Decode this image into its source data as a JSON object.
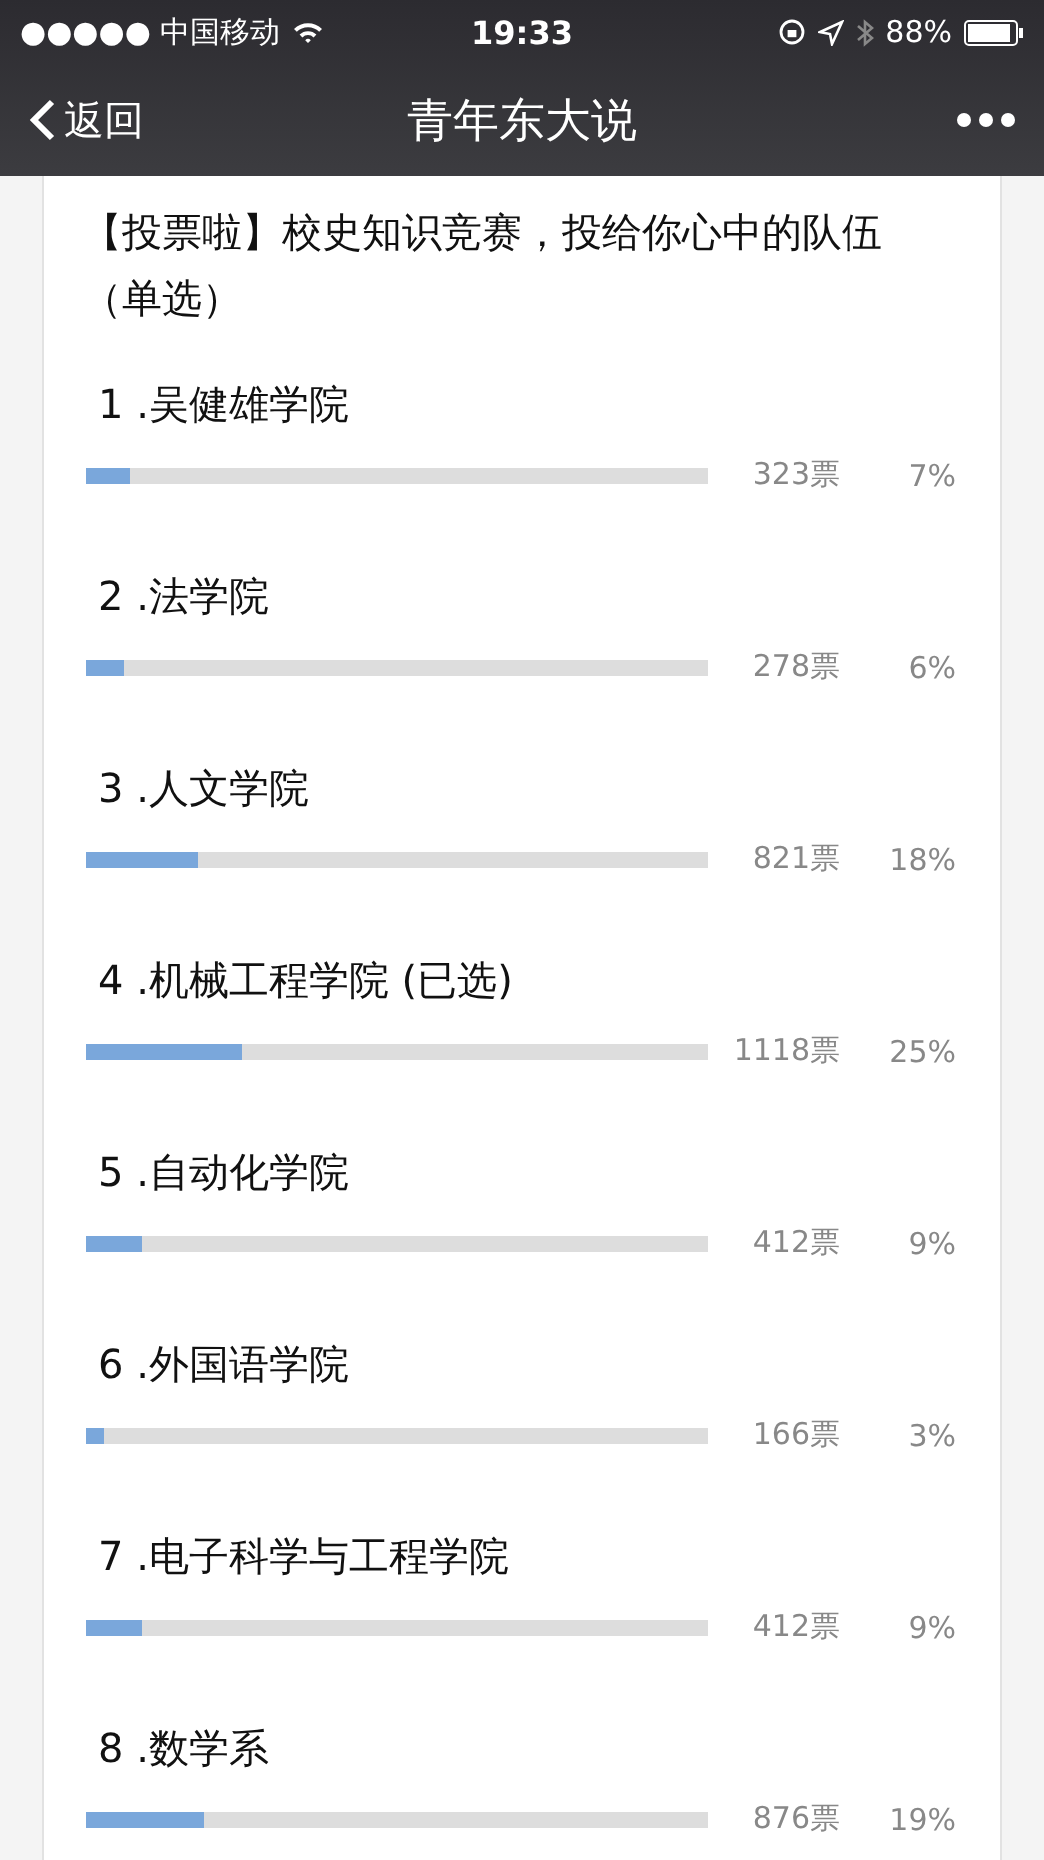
{
  "status_bar": {
    "carrier": "●●●●● 中国移动",
    "time": "19:33",
    "battery": "88%"
  },
  "nav": {
    "back": "返回",
    "title": "青年东大说"
  },
  "poll": {
    "title": "【投票啦】校史知识竞赛，投给你心中的队伍（单选）",
    "options": [
      {
        "label": "1 .吴健雄学院",
        "level": 0.07,
        "votes": "323票",
        "percent": "7%"
      },
      {
        "label": "2 .法学院",
        "level": 0.06,
        "votes": "278票",
        "percent": "6%"
      },
      {
        "label": "3 .人文学院",
        "level": 0.18,
        "votes": "821票",
        "percent": "18%"
      },
      {
        "label": "4 .机械工程学院 (已选)",
        "level": 0.25,
        "votes": "1118票",
        "percent": "25%"
      },
      {
        "label": "5 .自动化学院",
        "level": 0.09,
        "votes": "412票",
        "percent": "9%"
      },
      {
        "label": "6 .外国语学院",
        "level": 0.03,
        "votes": "166票",
        "percent": "3%"
      },
      {
        "label": "7 .电子科学与工程学院",
        "level": 0.09,
        "votes": "412票",
        "percent": "9%"
      },
      {
        "label": "8 .数学系",
        "level": 0.19,
        "votes": "876票",
        "percent": "19%"
      }
    ]
  }
}
